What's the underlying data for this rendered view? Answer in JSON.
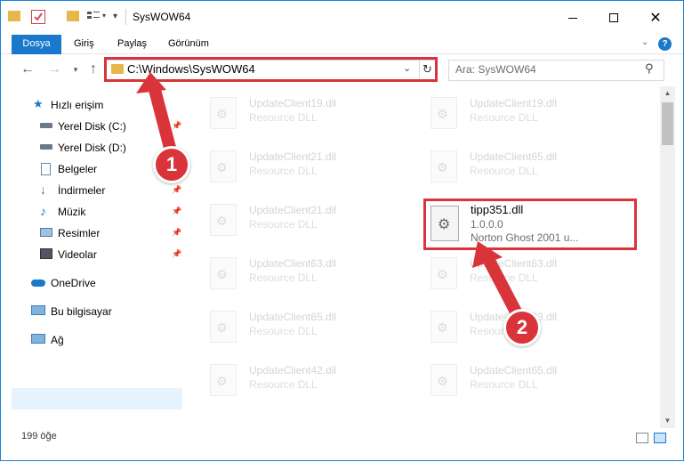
{
  "titlebar": {
    "title": "SysWOW64",
    "minimize_icon": "minimize-icon",
    "maximize_icon": "maximize-icon",
    "close_icon": "close-icon"
  },
  "ribbon": {
    "tabs": [
      "Dosya",
      "Giriş",
      "Paylaş",
      "Görünüm"
    ]
  },
  "address": {
    "path": "C:\\Windows\\SysWOW64",
    "search_placeholder": "Ara: SysWOW64"
  },
  "sidebar": {
    "quick_access": "Hızlı erişim",
    "items": [
      {
        "label": "Yerel Disk (C:)",
        "icon": "drive-icon"
      },
      {
        "label": "Yerel Disk (D:)",
        "icon": "drive-icon"
      },
      {
        "label": "Belgeler",
        "icon": "documents-icon"
      },
      {
        "label": "İndirmeler",
        "icon": "downloads-icon"
      },
      {
        "label": "Müzik",
        "icon": "music-icon"
      },
      {
        "label": "Resimler",
        "icon": "pictures-icon"
      },
      {
        "label": "Videolar",
        "icon": "videos-icon"
      }
    ],
    "onedrive": "OneDrive",
    "this_pc": "Bu bilgisayar",
    "network": "Ağ"
  },
  "files": [
    {
      "name": "UpdateClient19.dll",
      "desc": "Resource DLL"
    },
    {
      "name": "UpdateClient19.dll",
      "desc": "Resource DLL"
    },
    {
      "name": "UpdateClient21.dll",
      "desc": "Resource DLL"
    },
    {
      "name": "UpdateClient65.dll",
      "desc": "Resource DLL"
    },
    {
      "name": "UpdateClient21.dll",
      "desc": "Resource DLL"
    },
    {
      "name": "UpdateClient63.dll",
      "desc": "Resource DLL"
    },
    {
      "name": "UpdateClient63.dll",
      "desc": "Resource DLL"
    },
    {
      "name": "UpdateClient65.dll",
      "desc": "Resource DLL"
    },
    {
      "name": "UpdateClient63.dll",
      "desc": "Resource DLL"
    },
    {
      "name": "UpdateClient42.dll",
      "desc": "Resource DLL"
    },
    {
      "name": "UpdateClient65.dll",
      "desc": "Resource DLL"
    }
  ],
  "target_file": {
    "name": "tipp351.dll",
    "version": "1.0.0.0",
    "description": "Norton Ghost 2001 u..."
  },
  "status": {
    "count": "199 öğe"
  },
  "callouts": [
    "1",
    "2"
  ],
  "colors": {
    "accent": "#1979ca",
    "highlight": "#d8343a"
  }
}
